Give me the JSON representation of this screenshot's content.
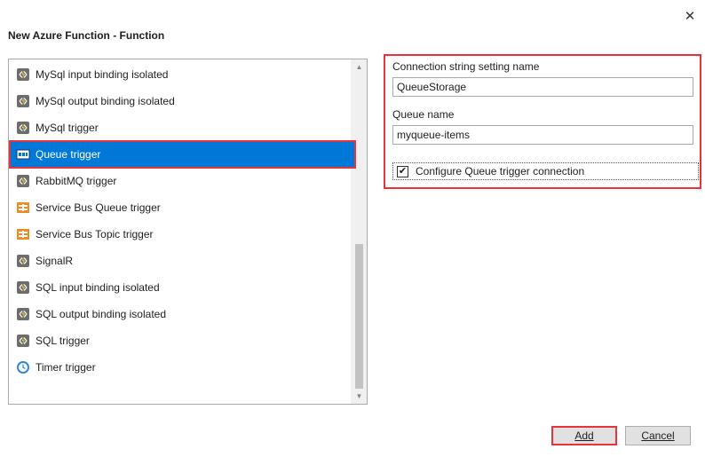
{
  "window": {
    "title": "New Azure Function - Function",
    "close_glyph": "✕"
  },
  "templates": {
    "items": [
      {
        "label": "MySql input binding isolated",
        "icon": "azure-function-icon",
        "selected": false
      },
      {
        "label": "MySql output binding isolated",
        "icon": "azure-function-icon",
        "selected": false
      },
      {
        "label": "MySql trigger",
        "icon": "azure-function-icon",
        "selected": false
      },
      {
        "label": "Queue trigger",
        "icon": "queue-storage-icon",
        "selected": true
      },
      {
        "label": "RabbitMQ trigger",
        "icon": "azure-function-icon",
        "selected": false
      },
      {
        "label": "Service Bus Queue trigger",
        "icon": "service-bus-icon",
        "selected": false
      },
      {
        "label": "Service Bus Topic trigger",
        "icon": "service-bus-icon",
        "selected": false
      },
      {
        "label": "SignalR",
        "icon": "azure-function-icon",
        "selected": false
      },
      {
        "label": "SQL input binding isolated",
        "icon": "azure-function-icon",
        "selected": false
      },
      {
        "label": "SQL output binding isolated",
        "icon": "azure-function-icon",
        "selected": false
      },
      {
        "label": "SQL trigger",
        "icon": "azure-function-icon",
        "selected": false
      },
      {
        "label": "Timer trigger",
        "icon": "timer-clock-icon",
        "selected": false
      }
    ]
  },
  "settings": {
    "connection_label": "Connection string setting name",
    "connection_value": "QueueStorage",
    "queue_label": "Queue name",
    "queue_value": "myqueue-items",
    "configure_label": "Configure Queue trigger connection",
    "configure_checked": true
  },
  "buttons": {
    "add_label": "Add",
    "cancel_label": "Cancel"
  },
  "colors": {
    "selection": "#0078d7",
    "highlight": "#e8333a"
  }
}
